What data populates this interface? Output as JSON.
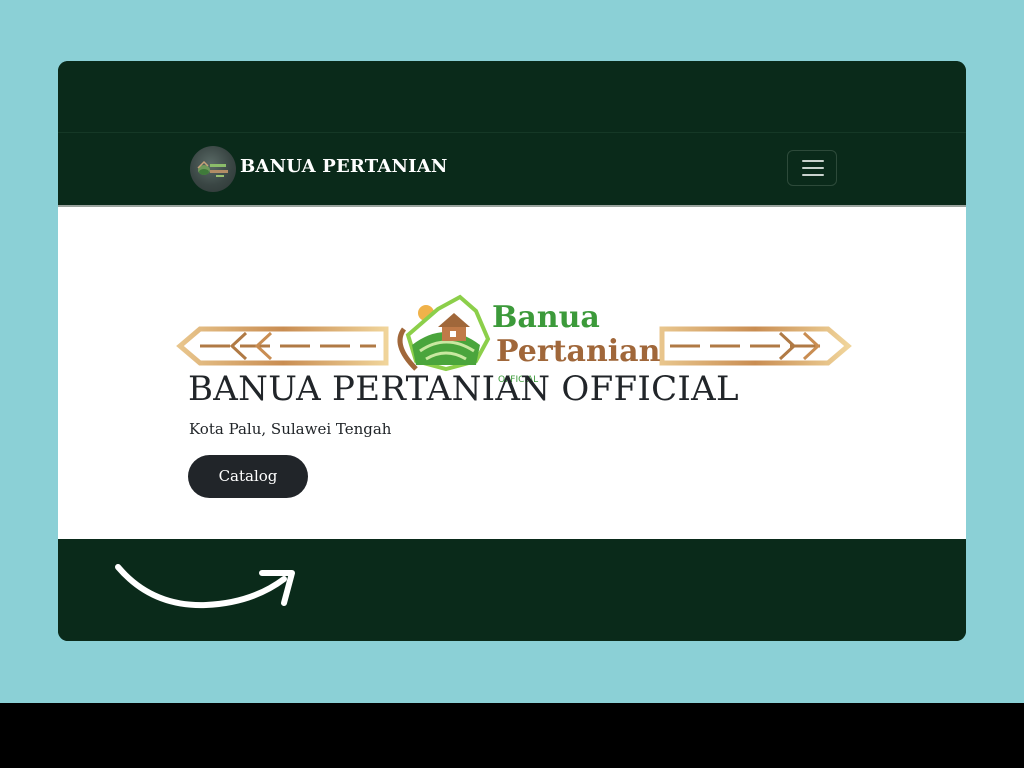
{
  "navbar": {
    "brand_title": "BANUA PERTANIAN",
    "menu_icon": "hamburger-menu-icon"
  },
  "hero": {
    "logo": {
      "word1": "Banua",
      "word2": "Pertanian",
      "word3": "OFFICIAL"
    },
    "title": "BANUA PERTANIAN OFFICIAL",
    "location": "Kota Palu, Sulawei Tengah",
    "catalog_label": "Catalog"
  },
  "footer": {
    "arrow_icon": "curved-arrow-icon"
  },
  "colors": {
    "page_bg": "#8bd0d6",
    "dark_green": "#0a2a1a",
    "button_dark": "#212529",
    "logo_green": "#3c9a3a",
    "logo_brown": "#a0673a",
    "logo_gold": "#d9b070"
  }
}
